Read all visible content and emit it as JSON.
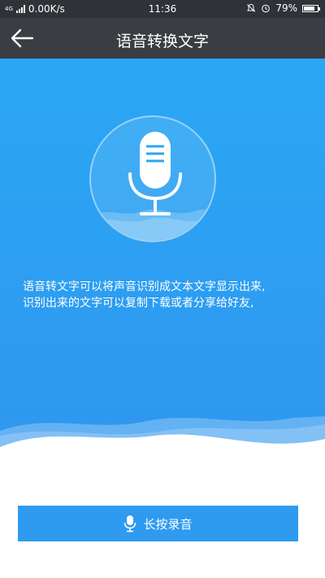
{
  "status_bar": {
    "network_type": "4G",
    "speed": "0.00K/s",
    "time": "11:36",
    "battery": "79%",
    "battery_level": 0.79,
    "icons": [
      "signal-icon",
      "mute-bell-icon",
      "alarm-icon",
      "battery-icon"
    ]
  },
  "header": {
    "title": "语音转换文字",
    "back_icon": "back-arrow-icon"
  },
  "hero": {
    "mic_icon": "microphone-icon",
    "description_lines": [
      "语音转文字可以将声音识别成文本文字显示出来,",
      "识别出来的文字可以复制下载或者分享给好友,"
    ]
  },
  "record_button": {
    "label": "长按录音",
    "icon": "microphone-icon"
  },
  "colors": {
    "status_bar_bg": "#2f3338",
    "title_bar_bg": "#3a3d42",
    "hero_blue": "#2aa7f4",
    "button_blue": "#2e9bf0",
    "text_white": "#ffffff"
  }
}
